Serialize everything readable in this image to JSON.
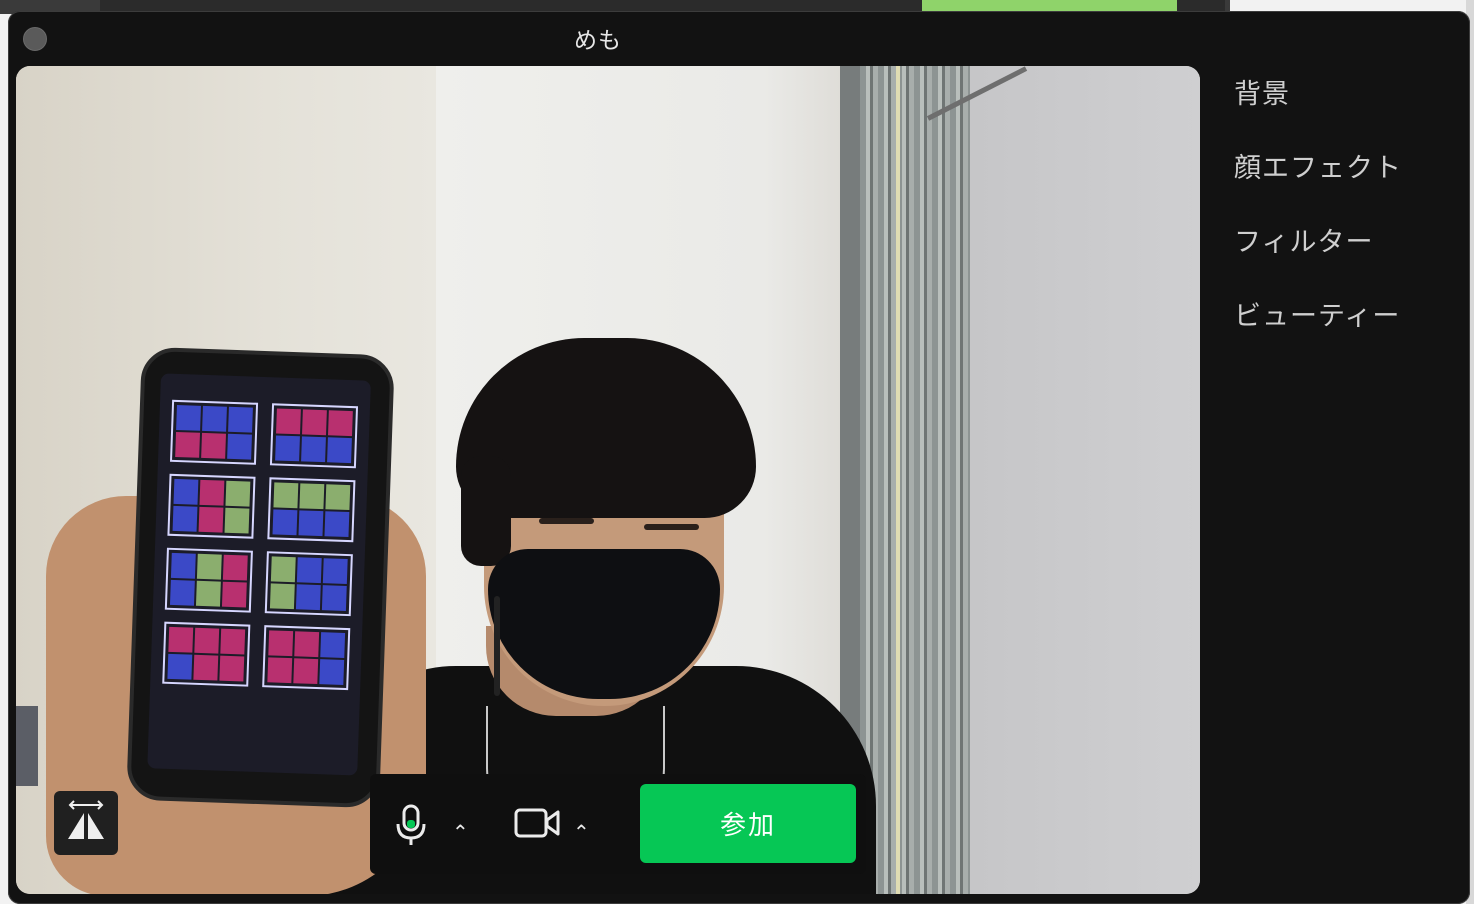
{
  "window": {
    "title": "めも"
  },
  "side_menu": {
    "items": [
      {
        "label": "背景"
      },
      {
        "label": "顔エフェクト"
      },
      {
        "label": "フィルター"
      },
      {
        "label": "ビューティー"
      }
    ]
  },
  "controls": {
    "join_label": "参加",
    "caret_glyph": "⌃",
    "join_color": "#06c755"
  },
  "icons": [
    "mirror-icon",
    "microphone-icon",
    "video-camera-icon",
    "chevron-up-icon"
  ]
}
